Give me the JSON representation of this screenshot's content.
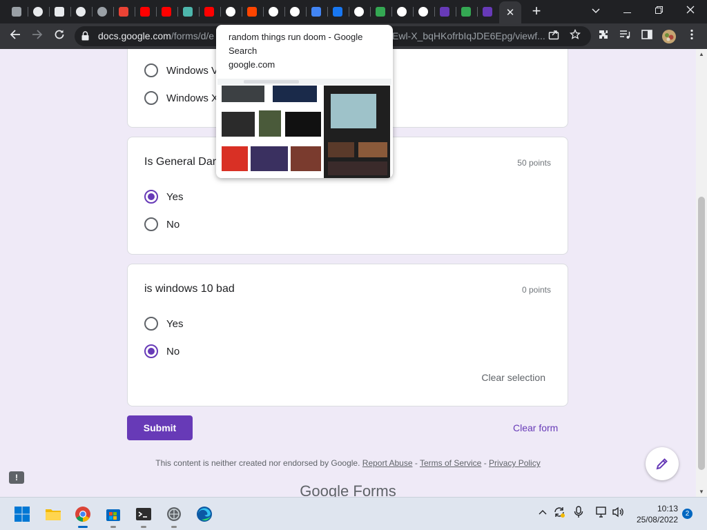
{
  "browser": {
    "tabs": [
      {
        "icon": "roblox-icon",
        "color": "#9aa0a6"
      },
      {
        "icon": "globe-icon",
        "color": "#e8eaed"
      },
      {
        "icon": "store-icon",
        "color": "#e8eaed"
      },
      {
        "icon": "chrome-icon",
        "color": "#e8eaed"
      },
      {
        "icon": "globe-icon",
        "color": "#9aa0a6"
      },
      {
        "icon": "record-icon",
        "color": "#ea4335"
      },
      {
        "icon": "youtube-icon",
        "color": "#ff0000"
      },
      {
        "icon": "youtube-icon",
        "color": "#ff0000"
      },
      {
        "icon": "translate-icon",
        "color": "#4db6ac"
      },
      {
        "icon": "youtube-icon",
        "color": "#ff0000"
      },
      {
        "icon": "google-icon",
        "color": "#ffffff"
      },
      {
        "icon": "reddit-icon",
        "color": "#ff4500"
      },
      {
        "icon": "globe-icon",
        "color": "#ffffff"
      },
      {
        "icon": "chrome-icon",
        "color": "#ffffff"
      },
      {
        "icon": "docs-icon",
        "color": "#4285f4"
      },
      {
        "icon": "meta-icon",
        "color": "#1877f2"
      },
      {
        "icon": "google-icon",
        "color": "#ffffff"
      },
      {
        "icon": "chat-icon",
        "color": "#34a853"
      },
      {
        "icon": "google-icon",
        "color": "#ffffff"
      },
      {
        "icon": "globe-icon",
        "color": "#ffffff"
      },
      {
        "icon": "forms-icon",
        "color": "#673ab7"
      },
      {
        "icon": "maps-icon",
        "color": "#34a853"
      },
      {
        "icon": "forms-icon",
        "color": "#673ab7"
      }
    ],
    "active_tab_close": "✕",
    "new_tab": "+",
    "url_domain": "docs.google.com",
    "url_path": "/forms/d/e",
    "url_tail": "Ewl-X_bqHKofrbIqJDE6Epg/viewf..."
  },
  "tooltip": {
    "title": "random things run doom - Google Search",
    "domain": "google.com"
  },
  "form": {
    "card1": {
      "options": [
        {
          "label": "Windows V",
          "selected": false
        },
        {
          "label": "Windows X",
          "selected": false
        }
      ]
    },
    "card2": {
      "question": "Is General Dari",
      "points": "50 points",
      "options": [
        {
          "label": "Yes",
          "selected": true
        },
        {
          "label": "No",
          "selected": false
        }
      ]
    },
    "card3": {
      "question": "is windows 10 bad",
      "points": "0 points",
      "options": [
        {
          "label": "Yes",
          "selected": false
        },
        {
          "label": "No",
          "selected": true
        }
      ],
      "clear_selection": "Clear selection"
    },
    "submit": "Submit",
    "clear_form": "Clear form",
    "disclaimer": "This content is neither created nor endorsed by Google.",
    "report_abuse": "Report Abuse",
    "terms": "Terms of Service",
    "privacy": "Privacy Policy",
    "sep": "-",
    "brand_google": "Google",
    "brand_forms": "Forms",
    "accent": "#673ab7"
  },
  "taskbar": {
    "clock_time": "10:13",
    "clock_date": "25/08/2022",
    "notifications": "2"
  }
}
